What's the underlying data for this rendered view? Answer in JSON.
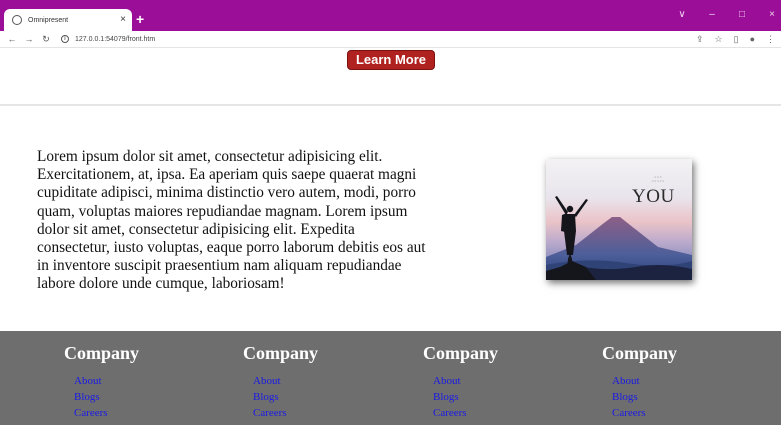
{
  "browser": {
    "tab_title": "Omnipresent",
    "tab_close": "×",
    "new_tab": "+",
    "url": "127.0.0.1:54079/front.htm",
    "window_controls": [
      "∨",
      "–",
      "□",
      "×"
    ],
    "accent_color": "#9b0e98"
  },
  "hero": {
    "button_label": "Learn More"
  },
  "content": {
    "paragraph": "Lorem ipsum dolor sit amet, consectetur adipisicing elit. Exercitationem, at, ipsa. Ea aperiam quis saepe quaerat magni cupiditate adipisci, minima distinctio vero autem, modi, porro quam, voluptas maiores repudiandae magnam. Lorem ipsum dolor sit amet, consectetur adipisicing elit. Expedita consectetur, iusto voluptas, eaque porro laborum debitis eos aut in inventore suscipit praesentium nam aliquam repudiandae labore dolore unde cumque, laboriosam!",
    "poster": {
      "word": "YOU"
    }
  },
  "footer": {
    "columns": [
      {
        "heading": "Company",
        "links": [
          "About",
          "Blogs",
          "Careers"
        ]
      },
      {
        "heading": "Company",
        "links": [
          "About",
          "Blogs",
          "Careers"
        ]
      },
      {
        "heading": "Company",
        "links": [
          "About",
          "Blogs",
          "Careers"
        ]
      },
      {
        "heading": "Company",
        "links": [
          "About",
          "Blogs",
          "Careers"
        ]
      }
    ]
  }
}
